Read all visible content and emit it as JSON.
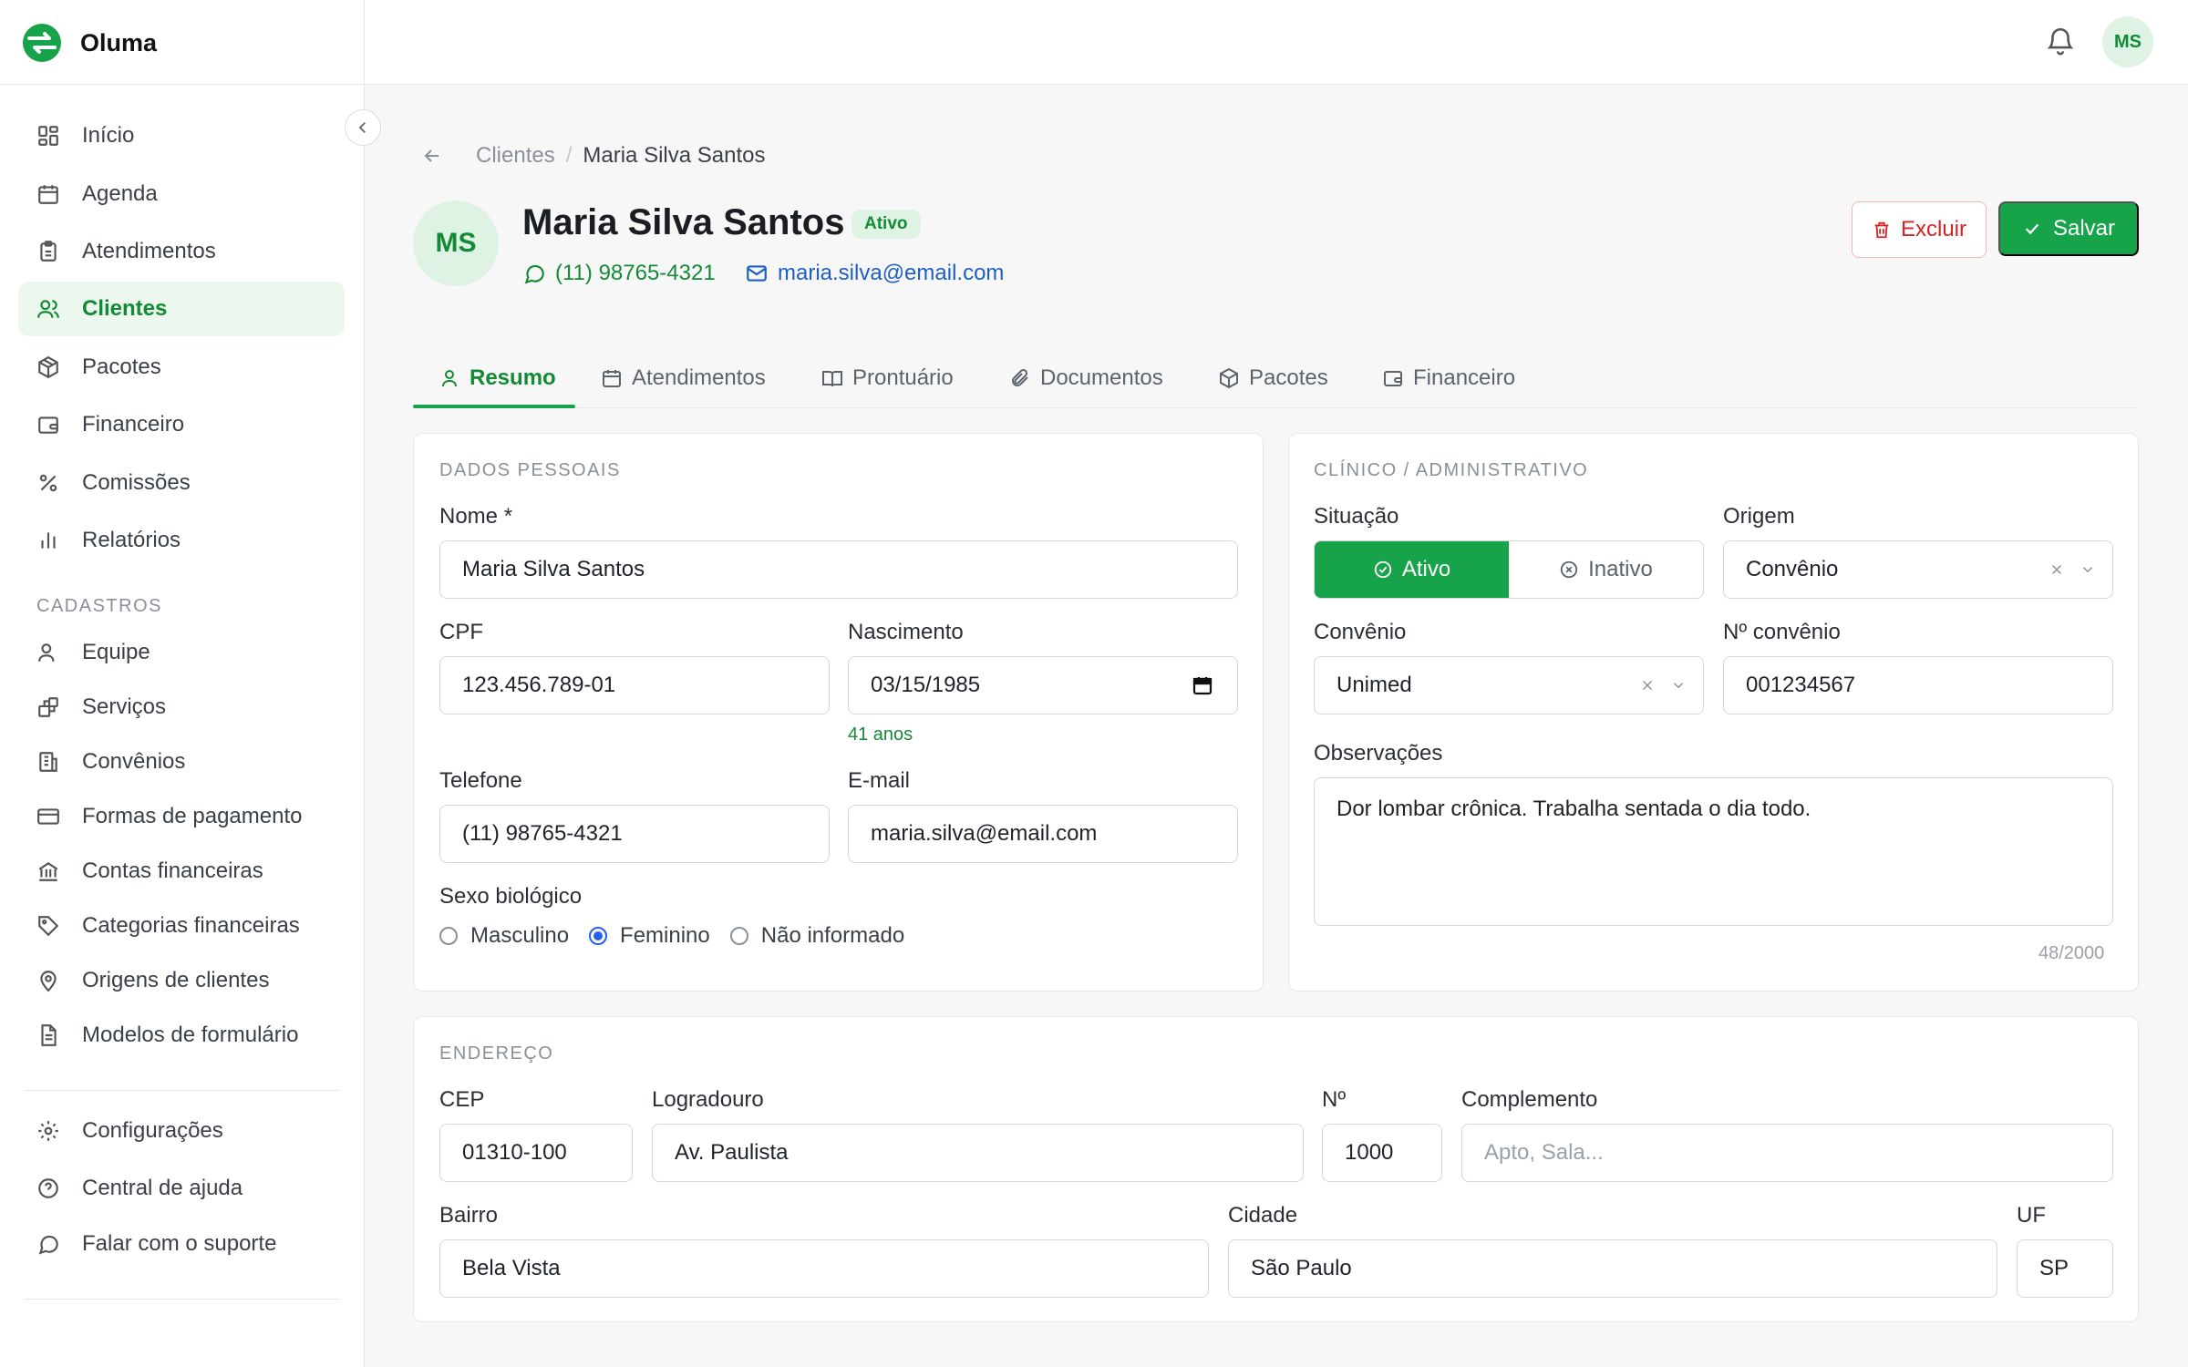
{
  "app": {
    "name": "Oluma"
  },
  "sidebar": {
    "items": [
      {
        "label": "Início",
        "icon": "grid-icon"
      },
      {
        "label": "Agenda",
        "icon": "calendar-icon"
      },
      {
        "label": "Atendimentos",
        "icon": "clipboard-icon"
      },
      {
        "label": "Clientes",
        "icon": "users-icon"
      },
      {
        "label": "Pacotes",
        "icon": "package-icon"
      },
      {
        "label": "Financeiro",
        "icon": "wallet-icon"
      },
      {
        "label": "Comissões",
        "icon": "percent-icon"
      },
      {
        "label": "Relatórios",
        "icon": "bar-chart-icon"
      }
    ],
    "section_label": "CADASTROS",
    "cadastros": [
      {
        "label": "Equipe",
        "icon": "user-icon"
      },
      {
        "label": "Serviços",
        "icon": "blocks-icon"
      },
      {
        "label": "Convênios",
        "icon": "building-icon"
      },
      {
        "label": "Formas de pagamento",
        "icon": "credit-card-icon"
      },
      {
        "label": "Contas financeiras",
        "icon": "bank-icon"
      },
      {
        "label": "Categorias financeiras",
        "icon": "tag-icon"
      },
      {
        "label": "Origens de clientes",
        "icon": "map-pin-icon"
      },
      {
        "label": "Modelos de formulário",
        "icon": "file-text-icon"
      }
    ],
    "footer": [
      {
        "label": "Configurações",
        "icon": "gear-icon"
      },
      {
        "label": "Central de ajuda",
        "icon": "help-circle-icon"
      },
      {
        "label": "Falar com o suporte",
        "icon": "chat-icon"
      }
    ]
  },
  "topbar": {
    "user_initials": "MS"
  },
  "breadcrumb": {
    "parent": "Clientes",
    "separator": "/",
    "current": "Maria Silva Santos"
  },
  "client": {
    "initials": "MS",
    "name": "Maria Silva Santos",
    "status": "Ativo",
    "phone": "(11) 98765-4321",
    "email": "maria.silva@email.com"
  },
  "actions": {
    "delete_label": "Excluir",
    "save_label": "Salvar"
  },
  "tabs": [
    "Resumo",
    "Atendimentos",
    "Prontuário",
    "Documentos",
    "Pacotes",
    "Financeiro"
  ],
  "personal": {
    "title": "DADOS PESSOAIS",
    "name_label": "Nome *",
    "name_value": "Maria Silva Santos",
    "cpf_label": "CPF",
    "cpf_value": "123.456.789-01",
    "birth_label": "Nascimento",
    "birth_value": "03/15/1985",
    "age": "41 anos",
    "phone_label": "Telefone",
    "phone_value": "(11) 98765-4321",
    "email_label": "E-mail",
    "email_value": "maria.silva@email.com",
    "sex_label": "Sexo biológico",
    "sex_options": [
      "Masculino",
      "Feminino",
      "Não informado"
    ],
    "sex_selected": "Feminino"
  },
  "clinical": {
    "title": "CLÍNICO / ADMINISTRATIVO",
    "status_label": "Situação",
    "status_options": [
      "Ativo",
      "Inativo"
    ],
    "origin_label": "Origem",
    "origin_value": "Convênio",
    "insurance_label": "Convênio",
    "insurance_value": "Unimed",
    "insurance_number_label": "Nº convênio",
    "insurance_number_value": "001234567",
    "notes_label": "Observações",
    "notes_value": "Dor lombar crônica. Trabalha sentada o dia todo.",
    "notes_counter": "48/2000"
  },
  "address": {
    "title": "ENDEREÇO",
    "cep_label": "CEP",
    "cep_value": "01310-100",
    "street_label": "Logradouro",
    "street_value": "Av. Paulista",
    "number_label": "Nº",
    "number_value": "1000",
    "complement_label": "Complemento",
    "complement_placeholder": "Apto, Sala...",
    "district_label": "Bairro",
    "district_value": "Bela Vista",
    "city_label": "Cidade",
    "city_value": "São Paulo",
    "state_label": "UF",
    "state_value": "SP"
  },
  "colors": {
    "brand_green": "#16a34a",
    "active_text": "#138a36",
    "danger": "#d32424",
    "link_blue": "#1d5fc4"
  }
}
